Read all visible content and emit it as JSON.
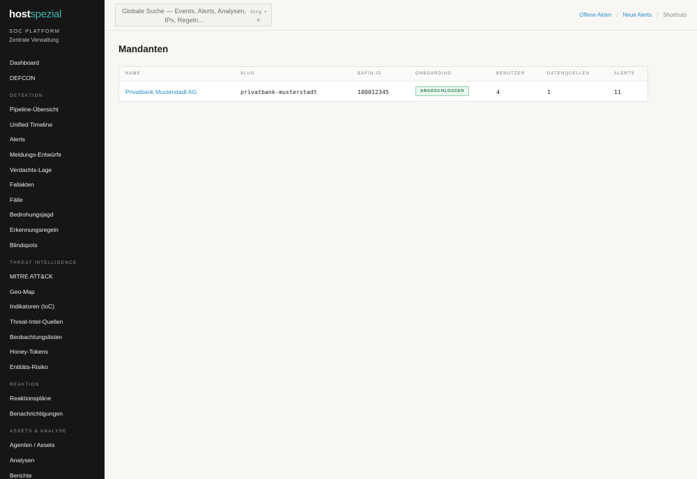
{
  "brand": {
    "logo_part1": "host",
    "logo_part2": "spezial",
    "platform": "SOC PLATFORM",
    "subtitle": "Zentrale Verwaltung"
  },
  "sidebar": {
    "top_items": [
      "Dashboard",
      "DEFCON"
    ],
    "sections": [
      {
        "title": "DETEKTION",
        "items": [
          "Pipeline-Übersicht",
          "Unified Timeline",
          "Alerts",
          "Meldungs-Entwürfe",
          "Verdachts-Lage",
          "Fallakten",
          "Fälle",
          "Bedrohungsjagd",
          "Erkennungsregeln",
          "Blindspots"
        ]
      },
      {
        "title": "THREAT INTELLIGENCE",
        "items": [
          "MITRE ATT&CK",
          "Geo-Map",
          "Indikatoren (IoC)",
          "Threat-Intel-Quellen",
          "Beobachtungslisten",
          "Honey-Tokens",
          "Entitäts-Risiko"
        ]
      },
      {
        "title": "REAKTION",
        "items": [
          "Reaktionspläne",
          "Benachrichtigungen"
        ]
      },
      {
        "title": "ASSETS & ANALYSE",
        "items": [
          "Agenten / Assets",
          "Analysen",
          "Berichte"
        ]
      }
    ]
  },
  "topbar": {
    "search_placeholder": "Globale Suche — Events, Alerts, Analysen, IPs, Regeln...",
    "search_shortcut": "Strg + K",
    "links": {
      "open_files": "Offene Akten",
      "new_alerts": "Neue Alerts",
      "shortcuts": "Shortcuts"
    }
  },
  "main": {
    "title": "Mandanten",
    "table": {
      "headers": {
        "name": "NAME",
        "slug": "SLUG",
        "bafin_id": "BAFIN-ID",
        "onboarding": "ONBOARDING",
        "users": "BENUTZER",
        "sources": "DATENQUELLEN",
        "alerts": "ALERTS"
      },
      "rows": [
        {
          "name": "Privatbank Musterstadt AG",
          "slug": "privatbank-musterstadt",
          "bafin_id": "100012345",
          "onboarding": "ABGESCHLOSSEN",
          "users": "4",
          "sources": "1",
          "alerts": "11"
        }
      ]
    }
  },
  "colors": {
    "sidebar_bg": "#161616",
    "accent_teal": "#3fb5ad",
    "link_blue": "#2a8fc9",
    "badge_green": "#2b7a4b"
  }
}
